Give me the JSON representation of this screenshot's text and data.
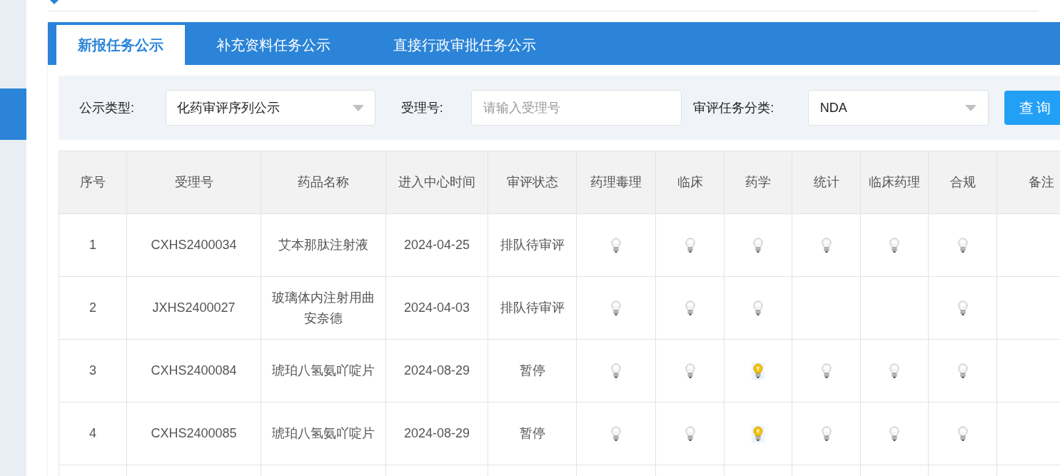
{
  "tabs": [
    {
      "label": "新报任务公示",
      "selected": true
    },
    {
      "label": "补充资料任务公示",
      "selected": false
    },
    {
      "label": "直接行政审批任务公示",
      "selected": false
    }
  ],
  "filters": {
    "type_label": "公示类型:",
    "type_value": "化药审评序列公示",
    "accept_label": "受理号:",
    "accept_placeholder": "请输入受理号",
    "category_label": "审评任务分类:",
    "category_value": "NDA",
    "query_button": "查询"
  },
  "table": {
    "columns": [
      "序号",
      "受理号",
      "药品名称",
      "进入中心时间",
      "审评状态",
      "药理毒理",
      "临床",
      "药学",
      "统计",
      "临床药理",
      "合规",
      "备注"
    ],
    "rows": [
      {
        "no": "1",
        "accept_no": "CXHS2400034",
        "drug": "艾本那肽注射液",
        "date": "2024-04-25",
        "status": "排队待审评",
        "lamps": [
          {
            "kind": "bulb",
            "lit": false
          },
          {
            "kind": "bulb",
            "lit": false
          },
          {
            "kind": "bulb",
            "lit": false
          },
          {
            "kind": "bulb",
            "lit": false
          },
          {
            "kind": "bulb",
            "lit": false
          },
          {
            "kind": "bulb",
            "lit": false
          }
        ]
      },
      {
        "no": "2",
        "accept_no": "JXHS2400027",
        "drug": "玻璃体内注射用曲安奈德",
        "date": "2024-04-03",
        "status": "排队待审评",
        "lamps": [
          {
            "kind": "bulb",
            "lit": false
          },
          {
            "kind": "bulb",
            "lit": false
          },
          {
            "kind": "bulb",
            "lit": false
          },
          {
            "kind": "none"
          },
          {
            "kind": "none"
          },
          {
            "kind": "bulb",
            "lit": false
          }
        ]
      },
      {
        "no": "3",
        "accept_no": "CXHS2400084",
        "drug": "琥珀八氢氨吖啶片",
        "date": "2024-08-29",
        "status": "暂停",
        "lamps": [
          {
            "kind": "bulb",
            "lit": false
          },
          {
            "kind": "bulb",
            "lit": false
          },
          {
            "kind": "bulb",
            "lit": true
          },
          {
            "kind": "bulb",
            "lit": false
          },
          {
            "kind": "bulb",
            "lit": false
          },
          {
            "kind": "bulb",
            "lit": false
          }
        ]
      },
      {
        "no": "4",
        "accept_no": "CXHS2400085",
        "drug": "琥珀八氢氨吖啶片",
        "date": "2024-08-29",
        "status": "暂停",
        "lamps": [
          {
            "kind": "bulb",
            "lit": false
          },
          {
            "kind": "bulb",
            "lit": false
          },
          {
            "kind": "bulb",
            "lit": true
          },
          {
            "kind": "bulb",
            "lit": false
          },
          {
            "kind": "bulb",
            "lit": false
          },
          {
            "kind": "bulb",
            "lit": false
          }
        ]
      }
    ]
  }
}
